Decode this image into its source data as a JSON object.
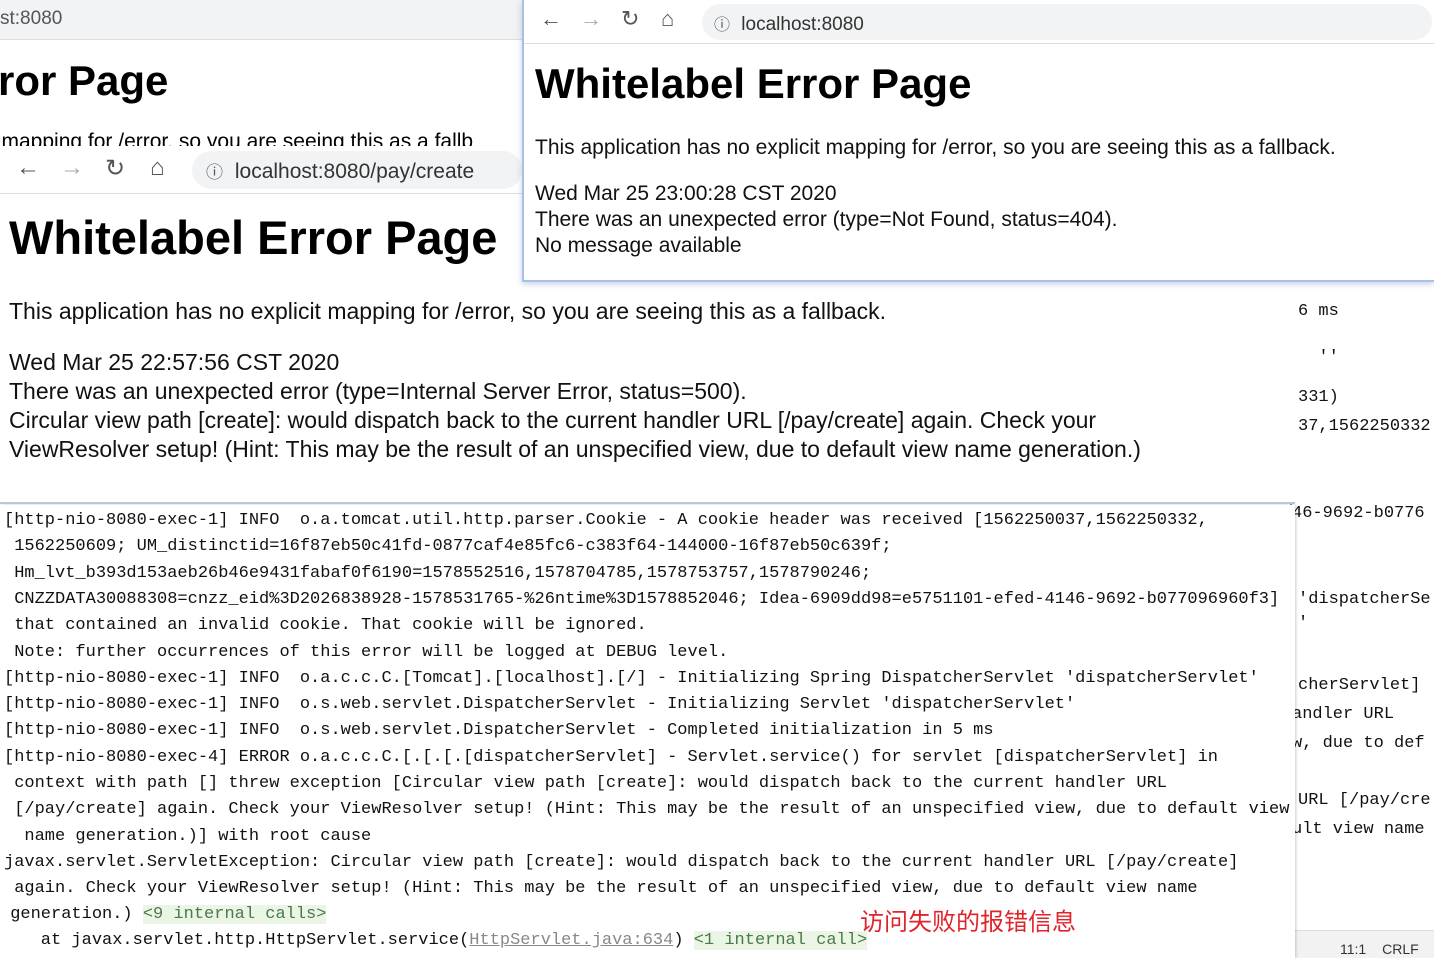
{
  "ide_fragments": [
    "6 ms",
    "  ''",
    "331)",
    "37,1562250332",
    "46-9692-b0776",
    "'dispatcherSe",
    "'",
    "cherServlet]",
    "andler URL",
    "w, due to def",
    "URL [/pay/cre",
    "ult view name"
  ],
  "ide_status": {
    "position": "11:1",
    "line_ending": "CRLF"
  },
  "browser_back": {
    "url": "st:8080",
    "title": "ror Page",
    "text": "icit mapping for /error, so you are seeing this as a fallb"
  },
  "browser_create": {
    "url": "localhost:8080/pay/create",
    "title": "Whitelabel Error Page",
    "lines": [
      "This application has no explicit mapping for /error, so you are seeing this as a fallback.",
      "Wed Mar 25 22:57:56 CST 2020",
      "There was an unexpected error (type=Internal Server Error, status=500).",
      "Circular view path [create]: would dispatch back to the current handler URL [/pay/create] again. Check your",
      "ViewResolver setup! (Hint: This may be the result of an unspecified view, due to default view name generation.)"
    ]
  },
  "browser_root": {
    "url": "localhost:8080",
    "title": "Whitelabel Error Page",
    "lines": [
      "This application has no explicit mapping for /error, so you are seeing this as a fallback.",
      "Wed Mar 25 23:00:28 CST 2020",
      "There was an unexpected error (type=Not Found, status=404).",
      "No message available"
    ]
  },
  "console": {
    "lines": [
      "[http-nio-8080-exec-1] INFO  o.a.tomcat.util.http.parser.Cookie - A cookie header was received [1562250037,1562250332,",
      " 1562250609; UM_distinctid=16f87eb50c41fd-0877caf4e85fc6-c383f64-144000-16f87eb50c639f;",
      " Hm_lvt_b393d153aeb26b46e9431fabaf0f6190=1578552516,1578704785,1578753757,1578790246;",
      " CNZZDATA30088308=cnzz_eid%3D2026838928-1578531765-%26ntime%3D1578852046; Idea-6909dd98=e5751101-efed-4146-9692-b077096960f3]",
      " that contained an invalid cookie. That cookie will be ignored.",
      " Note: further occurrences of this error will be logged at DEBUG level.",
      "[http-nio-8080-exec-1] INFO  o.a.c.c.C.[Tomcat].[localhost].[/] - Initializing Spring DispatcherServlet 'dispatcherServlet'",
      "[http-nio-8080-exec-1] INFO  o.s.web.servlet.DispatcherServlet - Initializing Servlet 'dispatcherServlet'",
      "[http-nio-8080-exec-1] INFO  o.s.web.servlet.DispatcherServlet - Completed initialization in 5 ms",
      "[http-nio-8080-exec-4] ERROR o.a.c.c.C.[.[.[.[dispatcherServlet] - Servlet.service() for servlet [dispatcherServlet] in",
      " context with path [] threw exception [Circular view path [create]: would dispatch back to the current handler URL",
      " [/pay/create] again. Check your ViewResolver setup! (Hint: This may be the result of an unspecified view, due to default view",
      "  name generation.)] with root cause",
      "javax.servlet.ServletException: Circular view path [create]: would dispatch back to the current handler URL [/pay/create]",
      " again. Check your ViewResolver setup! (Hint: This may be the result of an unspecified view, due to default view name"
    ],
    "gen_text": " generation.) ",
    "internal9": "<9 internal calls>",
    "at_text": "    at javax.servlet.http.HttpServlet.service(",
    "at_link": "HttpServlet.java:634",
    "at_close": ") ",
    "internal1": "<1 internal call>"
  },
  "annotation": {
    "text": "访问失败的报错信息",
    "color": "#e0242b"
  },
  "nav_icons": [
    "back-arrow-icon",
    "forward-arrow-icon",
    "reload-icon",
    "home-icon",
    "info-icon"
  ]
}
